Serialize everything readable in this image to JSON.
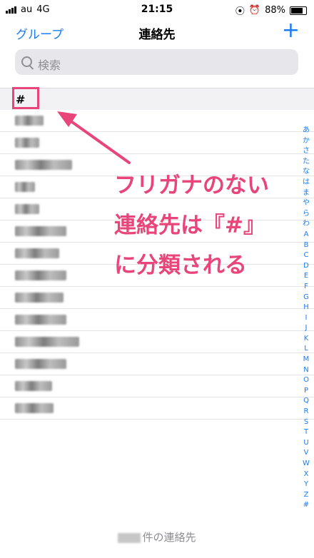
{
  "status": {
    "carrier": "au",
    "network": "4G",
    "time": "21:15",
    "battery": "88%",
    "battery_level": 0.88
  },
  "nav": {
    "left": "グループ",
    "title": "連絡先",
    "add": "+"
  },
  "search": {
    "placeholder": "検索"
  },
  "section": {
    "letter": "#"
  },
  "contacts": [
    {
      "name_width": 40
    },
    {
      "name_width": 34
    },
    {
      "name_width": 80
    },
    {
      "name_width": 28
    },
    {
      "name_width": 34
    },
    {
      "name_width": 72
    },
    {
      "name_width": 62
    },
    {
      "name_width": 72
    },
    {
      "name_width": 68
    },
    {
      "name_width": 72
    },
    {
      "name_width": 90
    },
    {
      "name_width": 72
    },
    {
      "name_width": 52
    },
    {
      "name_width": 54
    }
  ],
  "index": [
    "あ",
    "か",
    "さ",
    "た",
    "な",
    "は",
    "ま",
    "や",
    "ら",
    "わ",
    "A",
    "B",
    "C",
    "D",
    "E",
    "F",
    "G",
    "H",
    "I",
    "J",
    "K",
    "L",
    "M",
    "N",
    "O",
    "P",
    "Q",
    "R",
    "S",
    "T",
    "U",
    "V",
    "W",
    "X",
    "Y",
    "Z",
    "#"
  ],
  "annotation": {
    "lines": [
      "フリガナのない",
      "連絡先は『#』",
      "に分類される"
    ],
    "color": "#e8457a"
  },
  "footer": {
    "suffix": "件の連絡先"
  },
  "colors": {
    "accent": "#1a7cf5",
    "annotation": "#e8457a"
  }
}
